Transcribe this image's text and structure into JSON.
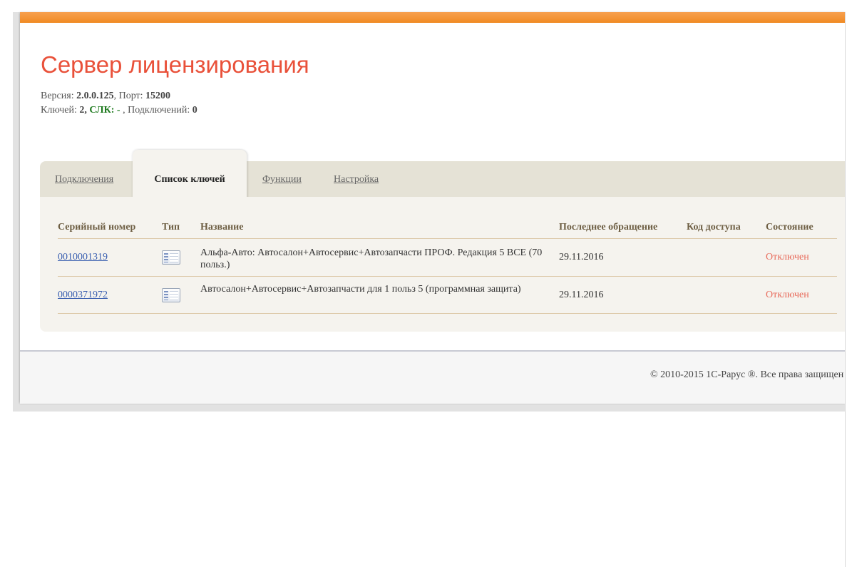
{
  "header": {
    "title": "Сервер лицензирования",
    "version_label": "Версия:",
    "version_value": "2.0.0.125",
    "port_label": ", Порт:",
    "port_value": "15200",
    "keys_label": "Ключей:",
    "keys_value": "2,",
    "slk_label": "СЛК:",
    "slk_value": "-",
    "connections_label": ", Подключений:",
    "connections_value": "0"
  },
  "tabs": [
    {
      "label": "Подключения",
      "active": false
    },
    {
      "label": "Список ключей",
      "active": true
    },
    {
      "label": "Функции",
      "active": false
    },
    {
      "label": "Настройка",
      "active": false
    }
  ],
  "table": {
    "columns": [
      "Серийный номер",
      "Тип",
      "Название",
      "Последнее обращение",
      "Код доступа",
      "Состояние"
    ],
    "rows": [
      {
        "serial": "0010001319",
        "type_icon": "license-key-icon",
        "name": "Альфа-Авто: Автосалон+Автосервис+Автозапчасти ПРОФ. Редакция 5 ВСЕ (70 польз.)",
        "last_access": "29.11.2016",
        "access_code": "",
        "state": "Отключен"
      },
      {
        "serial": "0000371972",
        "type_icon": "license-key-icon",
        "name": "Автосалон+Автосервис+Автозапчасти для 1 польз 5 (программная защита)",
        "last_access": "29.11.2016",
        "access_code": "",
        "state": "Отключен"
      }
    ]
  },
  "footer": {
    "copyright": "© 2010-2015 1С-Рарус ®. Все права защищен"
  },
  "colors": {
    "accent_bar": "#f08a23",
    "title": "#e9513a",
    "slk": "#1e7a1e",
    "state_disabled": "#e86a5a",
    "link": "#3a5fb0"
  }
}
